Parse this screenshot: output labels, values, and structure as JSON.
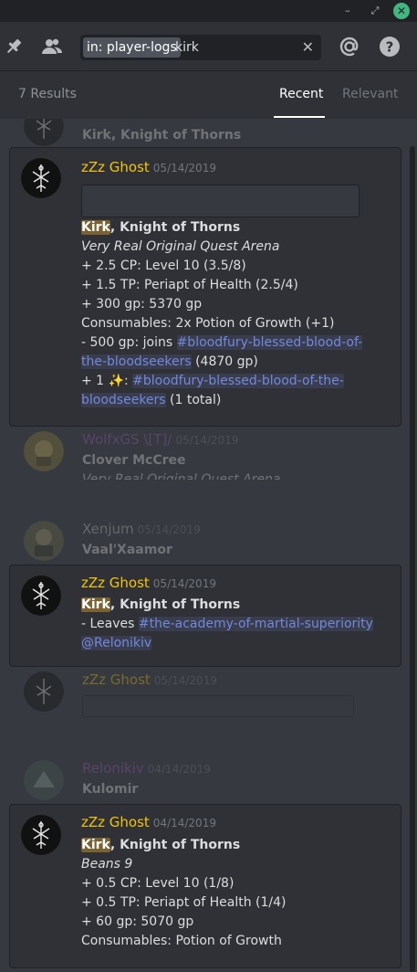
{
  "window": {
    "min": "–",
    "max": "⤢",
    "close": "✕"
  },
  "header": {
    "pin_icon": "pin-icon",
    "members_icon": "members-icon",
    "search_chip": "in: player-logs",
    "search_query": "kirk",
    "clear": "✕",
    "mention_icon": "at-icon",
    "help_icon": "help-icon"
  },
  "results_bar": {
    "count": "7 Results",
    "tab_recent": "Recent",
    "tab_relevant": "Relevant"
  },
  "results": [
    {
      "type": "context",
      "line": "Kirk, Knight of Thorns"
    },
    {
      "type": "hit",
      "author": "zZz Ghost",
      "date": "05/14/2019",
      "lines": {
        "l1a": "Kirk",
        "l1b": ", Knight of Thorns",
        "l2": "Very Real Original Quest Arena",
        "l3": "+ 2.5 CP: Level 10 (3.5/8)",
        "l4": "+ 1.5 TP: Periapt of Health (2.5/4)",
        "l5": "+ 300 gp: 5370 gp",
        "l6": "Consumables: 2x Potion of Growth (+1)",
        "l7a": "- 500 gp: joins ",
        "l7b": "#bloodfury-blessed-blood-of-",
        "l8a": "the-bloodseekers",
        "l8b": " (4870 gp)",
        "l9a": "+ 1 ",
        "l9b": "✨",
        "l9c": ": ",
        "l9d": "#bloodfury-blessed-blood-of-the-",
        "l10a": "bloodseekers",
        "l10b": " (1 total)"
      }
    },
    {
      "type": "context",
      "author": "WolfxGS \\[T]/",
      "date": "05/14/2019",
      "line1": "Clover McCree",
      "line2": "Very Real Original Quest Arena"
    },
    {
      "type": "context",
      "author": "Xenjum",
      "date": "05/14/2019",
      "line1": "Vaal'Xaamor"
    },
    {
      "type": "hit",
      "author": "zZz Ghost",
      "date": "05/14/2019",
      "lines": {
        "l1a": "Kirk",
        "l1b": ", Knight of Thorns",
        "l2a": "- Leaves ",
        "l2b": "#the-academy-of-martial-superiority",
        "l3": "@Relonikiv"
      }
    },
    {
      "type": "context",
      "author": "zZz Ghost",
      "date": "05/14/2019"
    },
    {
      "type": "context",
      "author": "Relonikiv",
      "date": "04/14/2019",
      "line1": "Kulomir"
    },
    {
      "type": "hit",
      "author": "zZz Ghost",
      "date": "04/14/2019",
      "lines": {
        "l1a": "Kirk",
        "l1b": ", Knight of Thorns",
        "l2": "Beans 9",
        "l3": "+ 0.5 CP: Level 10 (1/8)",
        "l4": "+ 0.5 TP: Periapt of Health (1/4)",
        "l5": "+ 60 gp: 5070 gp",
        "l6": "Consumables: Potion of Growth"
      }
    }
  ],
  "colors": {
    "author_gold": "#f1c40f",
    "author_purple": "#9b59b6",
    "channel_blue": "#7289da",
    "highlight": "#7a6233",
    "background": "#36393f"
  }
}
